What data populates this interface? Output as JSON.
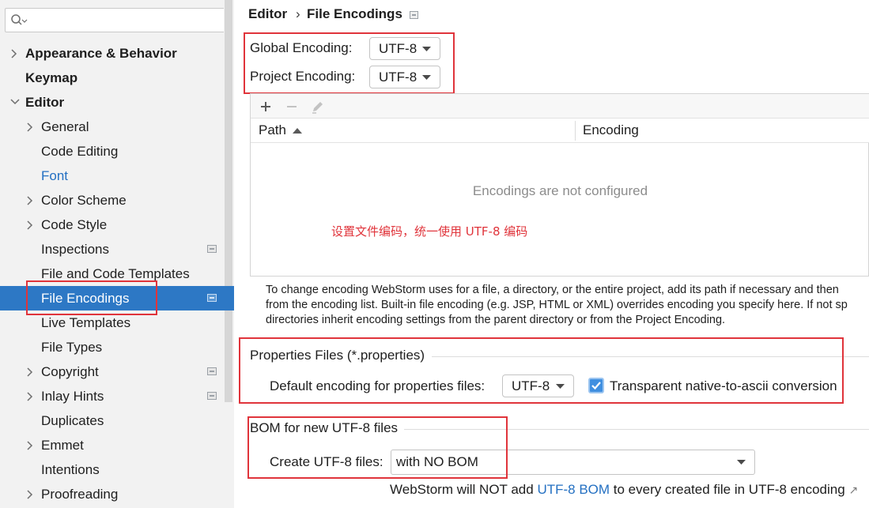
{
  "search": {
    "placeholder": "",
    "value": ""
  },
  "sidebar": {
    "items": [
      {
        "label": "Appearance & Behavior"
      },
      {
        "label": "Keymap"
      },
      {
        "label": "Editor"
      },
      {
        "label": "General"
      },
      {
        "label": "Code Editing"
      },
      {
        "label": "Font"
      },
      {
        "label": "Color Scheme"
      },
      {
        "label": "Code Style"
      },
      {
        "label": "Inspections"
      },
      {
        "label": "File and Code Templates"
      },
      {
        "label": "File Encodings"
      },
      {
        "label": "Live Templates"
      },
      {
        "label": "File Types"
      },
      {
        "label": "Copyright"
      },
      {
        "label": "Inlay Hints"
      },
      {
        "label": "Duplicates"
      },
      {
        "label": "Emmet"
      },
      {
        "label": "Intentions"
      },
      {
        "label": "Proofreading"
      }
    ]
  },
  "breadcrumb": {
    "parent": "Editor",
    "separator": "›",
    "current": "File Encodings"
  },
  "global_encoding": {
    "label": "Global Encoding:",
    "value": "UTF-8"
  },
  "project_encoding": {
    "label": "Project Encoding:",
    "value": "UTF-8"
  },
  "table": {
    "columns": {
      "path": "Path",
      "encoding": "Encoding"
    },
    "empty_text": "Encodings are not configured"
  },
  "annotation": "设置文件编码，统一使用 UTF-8 编码",
  "help_text": {
    "line1": "To change encoding WebStorm uses for a file, a directory, or the entire project, add its path if necessary and then",
    "line2": "from the encoding list. Built-in file encoding (e.g. JSP, HTML or XML) overrides encoding you specify here. If not sp",
    "line3": "directories inherit encoding settings from the parent directory or from the Project Encoding."
  },
  "properties": {
    "title": "Properties Files (*.properties)",
    "default_label": "Default encoding for properties files:",
    "default_value": "UTF-8",
    "transparent_label": "Transparent native-to-ascii conversion",
    "transparent_checked": true
  },
  "bom": {
    "title": "BOM for new UTF-8 files",
    "create_label": "Create UTF-8 files:",
    "create_value": "with NO BOM",
    "note_prefix": "WebStorm will NOT add ",
    "note_link": "UTF-8 BOM",
    "note_suffix": " to every created file in UTF-8 encoding",
    "note_arrow": "↗"
  },
  "colors": {
    "selection": "#2d78c5",
    "link": "#2470c2",
    "highlight_box": "#e0343b",
    "checkbox": "#3f8fe0"
  }
}
